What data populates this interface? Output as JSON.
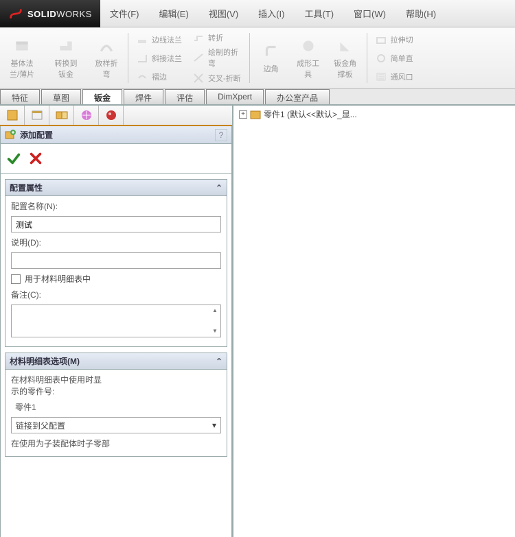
{
  "brand": {
    "prefix": "SOLID",
    "suffix": "WORKS"
  },
  "menus": [
    "文件(F)",
    "编辑(E)",
    "视图(V)",
    "插入(I)",
    "工具(T)",
    "窗口(W)",
    "帮助(H)"
  ],
  "ribbon": {
    "big": [
      {
        "label": "基体法\n兰/薄片"
      },
      {
        "label": "转换到\n钣金"
      },
      {
        "label": "放样折\n弯"
      }
    ],
    "col1": [
      "边线法兰",
      "斜接法兰",
      "褶边"
    ],
    "col2": [
      "转折",
      "绘制的折\n弯",
      "交叉-折断"
    ],
    "big2": [
      {
        "label": "边角"
      },
      {
        "label": "成形工\n具"
      },
      {
        "label": "钣金角\n撑板"
      }
    ],
    "col3": [
      "拉伸切",
      "简单直",
      "通风口"
    ]
  },
  "cmtabs": [
    "特征",
    "草图",
    "钣金",
    "焊件",
    "评估",
    "DimXpert",
    "办公室产品"
  ],
  "cmtabs_active_index": 2,
  "pm": {
    "title": "添加配置",
    "sec_props": {
      "title": "配置属性",
      "name_label": "配置名称(N):",
      "name_value": "测试",
      "desc_label": "说明(D):",
      "desc_value": "",
      "bom_checkbox": "用于材料明细表中",
      "comments_label": "备注(C):"
    },
    "sec_bom": {
      "title": "材料明细表选项(M)",
      "hint": "在材料明细表中使用时显\n示的零件号:",
      "partno": "零件1",
      "link_option": "链接到父配置",
      "child_hint": "在使用为子装配体时子零部"
    }
  },
  "tree": {
    "root": "零件1 (默认<<默认>_显..."
  }
}
